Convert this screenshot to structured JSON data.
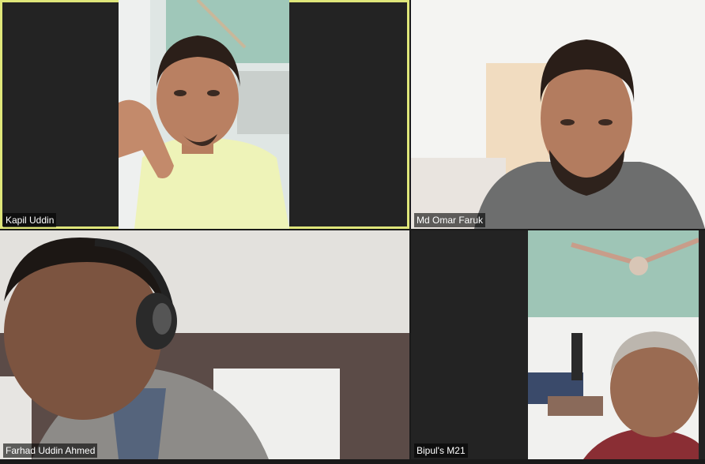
{
  "participants": [
    {
      "name": "Kapil Uddin",
      "active_speaker": true
    },
    {
      "name": "Md Omar Faruk",
      "active_speaker": false
    },
    {
      "name": "Farhad Uddin Ahmed",
      "active_speaker": false
    },
    {
      "name": "Bipul's M21",
      "active_speaker": false
    }
  ],
  "colors": {
    "background": "#1a1a1a",
    "tile": "#232323",
    "active_speaker_border": "#dfe67a"
  }
}
